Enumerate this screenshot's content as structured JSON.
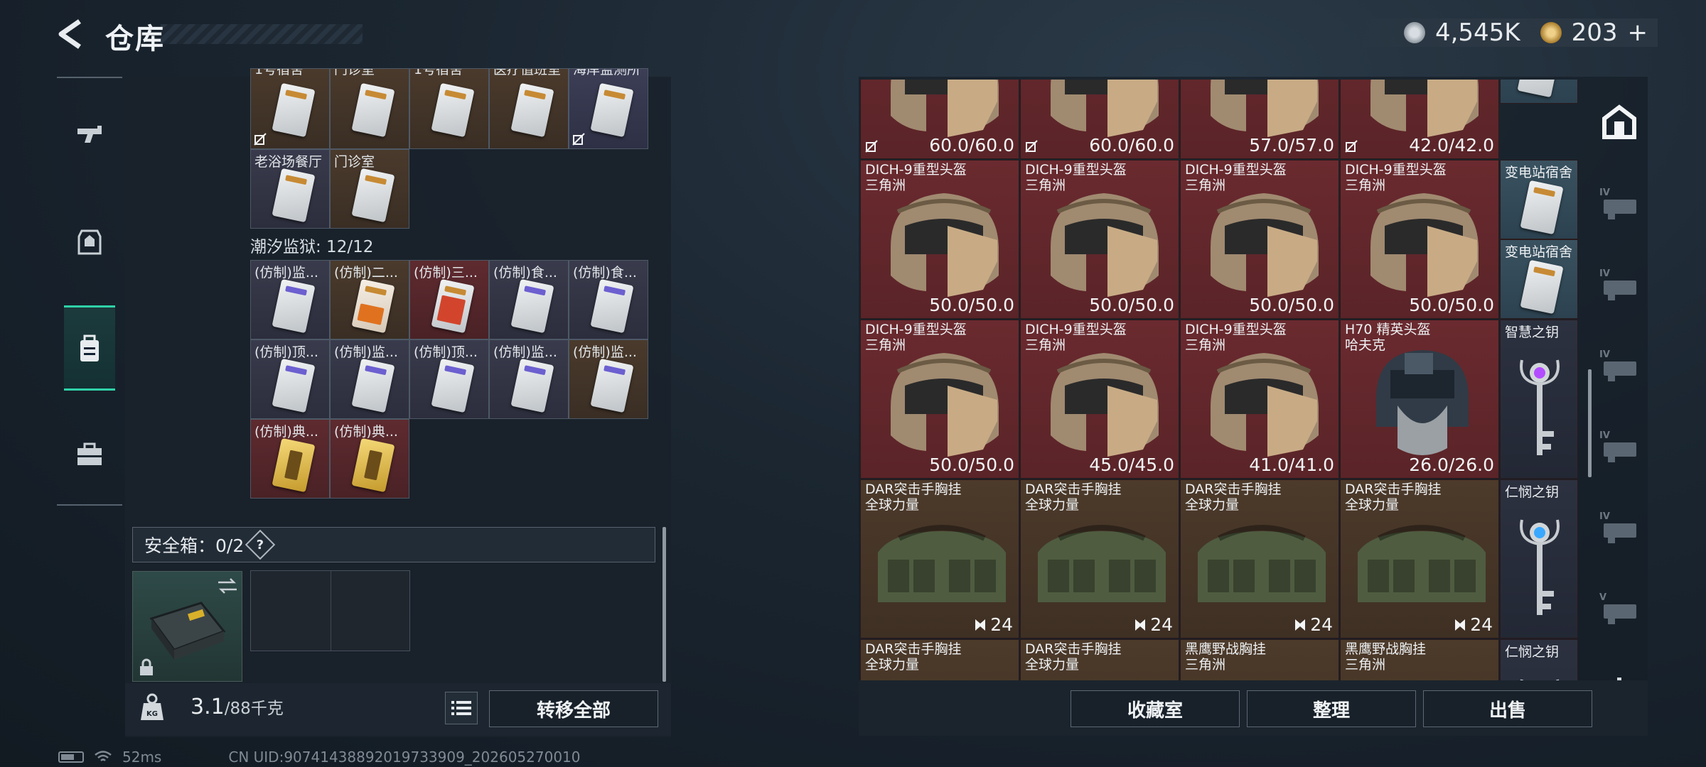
{
  "header": {
    "title": "仓库",
    "currency": [
      {
        "name": "silver-coin-icon",
        "value": "4,545K",
        "color": "#b9c2c9"
      },
      {
        "name": "gold-coin-icon",
        "value": "203",
        "color": "#c9a24a"
      }
    ],
    "add_symbol": "+"
  },
  "rail": [
    {
      "name": "weapon",
      "icon": "gun-icon",
      "active": false
    },
    {
      "name": "armor",
      "icon": "armor-icon",
      "active": false
    },
    {
      "name": "backpack",
      "icon": "backpack-icon",
      "active": true
    },
    {
      "name": "toolbox",
      "icon": "briefcase-icon",
      "active": false
    }
  ],
  "left": {
    "top_row": [
      {
        "label": "1号宿舍",
        "bg": "brown",
        "card": "plain",
        "locked": true
      },
      {
        "label": "门诊室",
        "bg": "brown",
        "card": "plain",
        "locked": false
      },
      {
        "label": "1号宿舍",
        "bg": "brown",
        "card": "plain",
        "locked": false
      },
      {
        "label": "医疗值班室",
        "bg": "brown",
        "card": "plain",
        "locked": false
      },
      {
        "label": "海岸监测所",
        "bg": "navy",
        "card": "plain",
        "locked": true
      }
    ],
    "row2": [
      {
        "label": "老浴场餐厅",
        "bg": "dark",
        "card": "plain"
      },
      {
        "label": "门诊室",
        "bg": "brown",
        "card": "plain"
      }
    ],
    "section_title": "潮汐监狱: 12/12",
    "prison_rows": [
      [
        {
          "label": "(仿制)监...",
          "bg": "dark",
          "card": "purple"
        },
        {
          "label": "(仿制)二...",
          "bg": "brown",
          "card": "orange"
        },
        {
          "label": "(仿制)三...",
          "bg": "red",
          "card": "redc"
        },
        {
          "label": "(仿制)食...",
          "bg": "dark",
          "card": "purple"
        },
        {
          "label": "(仿制)食...",
          "bg": "dark",
          "card": "purple"
        }
      ],
      [
        {
          "label": "(仿制)顶...",
          "bg": "dark",
          "card": "purple"
        },
        {
          "label": "(仿制)监...",
          "bg": "dark",
          "card": "purple"
        },
        {
          "label": "(仿制)顶...",
          "bg": "dark",
          "card": "purple"
        },
        {
          "label": "(仿制)监...",
          "bg": "dark",
          "card": "purple"
        },
        {
          "label": "(仿制)监...",
          "bg": "brown",
          "card": "purple"
        }
      ],
      [
        {
          "label": "(仿制)典...",
          "bg": "red",
          "card": "gold"
        },
        {
          "label": "(仿制)典...",
          "bg": "red",
          "card": "gold"
        }
      ]
    ],
    "safe_box": {
      "text": "安全箱：0/2",
      "help": "?"
    },
    "weight": {
      "current": "3.1",
      "max": "/88千克"
    },
    "transfer_all": "转移全部"
  },
  "right": {
    "top_values": [
      {
        "value": "60.0/60.0",
        "nolabel": true
      },
      {
        "value": "60.0/60.0",
        "nolabel": true
      },
      {
        "value": "57.0/57.0",
        "nolabel": false
      },
      {
        "value": "42.0/42.0",
        "nolabel": true
      }
    ],
    "rows": [
      [
        {
          "name": "DICH-9重型头盔",
          "sub": "三角洲",
          "value": "50.0/50.0",
          "type": "helmet",
          "bg": "red"
        },
        {
          "name": "DICH-9重型头盔",
          "sub": "三角洲",
          "value": "50.0/50.0",
          "type": "helmet",
          "bg": "red"
        },
        {
          "name": "DICH-9重型头盔",
          "sub": "三角洲",
          "value": "50.0/50.0",
          "type": "helmet",
          "bg": "red"
        },
        {
          "name": "DICH-9重型头盔",
          "sub": "三角洲",
          "value": "50.0/50.0",
          "type": "helmet",
          "bg": "red"
        }
      ],
      [
        {
          "name": "DICH-9重型头盔",
          "sub": "三角洲",
          "value": "50.0/50.0",
          "type": "helmet",
          "bg": "red"
        },
        {
          "name": "DICH-9重型头盔",
          "sub": "三角洲",
          "value": "45.0/45.0",
          "type": "helmet",
          "bg": "red"
        },
        {
          "name": "DICH-9重型头盔",
          "sub": "三角洲",
          "value": "41.0/41.0",
          "type": "helmet",
          "bg": "red"
        },
        {
          "name": "H70 精英头盔",
          "sub": "哈夫克",
          "value": "26.0/26.0",
          "type": "h70",
          "bg": "red"
        }
      ],
      [
        {
          "name": "DAR突击手胸挂",
          "sub": "全球力量",
          "value": "24",
          "type": "rig",
          "bg": "brown"
        },
        {
          "name": "DAR突击手胸挂",
          "sub": "全球力量",
          "value": "24",
          "type": "rig",
          "bg": "brown"
        },
        {
          "name": "DAR突击手胸挂",
          "sub": "全球力量",
          "value": "24",
          "type": "rig",
          "bg": "brown"
        },
        {
          "name": "DAR突击手胸挂",
          "sub": "全球力量",
          "value": "24",
          "type": "rig",
          "bg": "brown"
        }
      ],
      [
        {
          "name": "DAR突击手胸挂",
          "sub": "全球力量",
          "value": "",
          "type": "rig",
          "bg": "brown"
        },
        {
          "name": "DAR突击手胸挂",
          "sub": "全球力量",
          "value": "",
          "type": "rig",
          "bg": "brown"
        },
        {
          "name": "黑鹰野战胸挂",
          "sub": "三角洲",
          "value": "",
          "type": "rig2",
          "bg": "brown"
        },
        {
          "name": "黑鹰野战胸挂",
          "sub": "三角洲",
          "value": "",
          "type": "rig2",
          "bg": "brown"
        }
      ]
    ],
    "side_cards": [
      {
        "label": "变电站宿舍"
      },
      {
        "label": "变电站宿舍"
      }
    ],
    "side_keys": [
      {
        "label": "智慧之钥",
        "gem": "#b34cff"
      },
      {
        "label": "仁悯之钥",
        "gem": "#3aa8ff"
      },
      {
        "label": "仁悯之钥",
        "gem": "#3aa8ff"
      }
    ],
    "categories": [
      "all-icon",
      "iv-gun-icon",
      "iv-rifle-icon",
      "iv-ammo-icon",
      "iv-armor-icon",
      "iv-medkit-icon",
      "v-gear-icon"
    ],
    "actions": {
      "collection": "收藏室",
      "sort": "整理",
      "sell": "出售"
    }
  },
  "status": {
    "ping": "52ms",
    "uid": "CN UID:90741438892019733909_202605270010"
  }
}
